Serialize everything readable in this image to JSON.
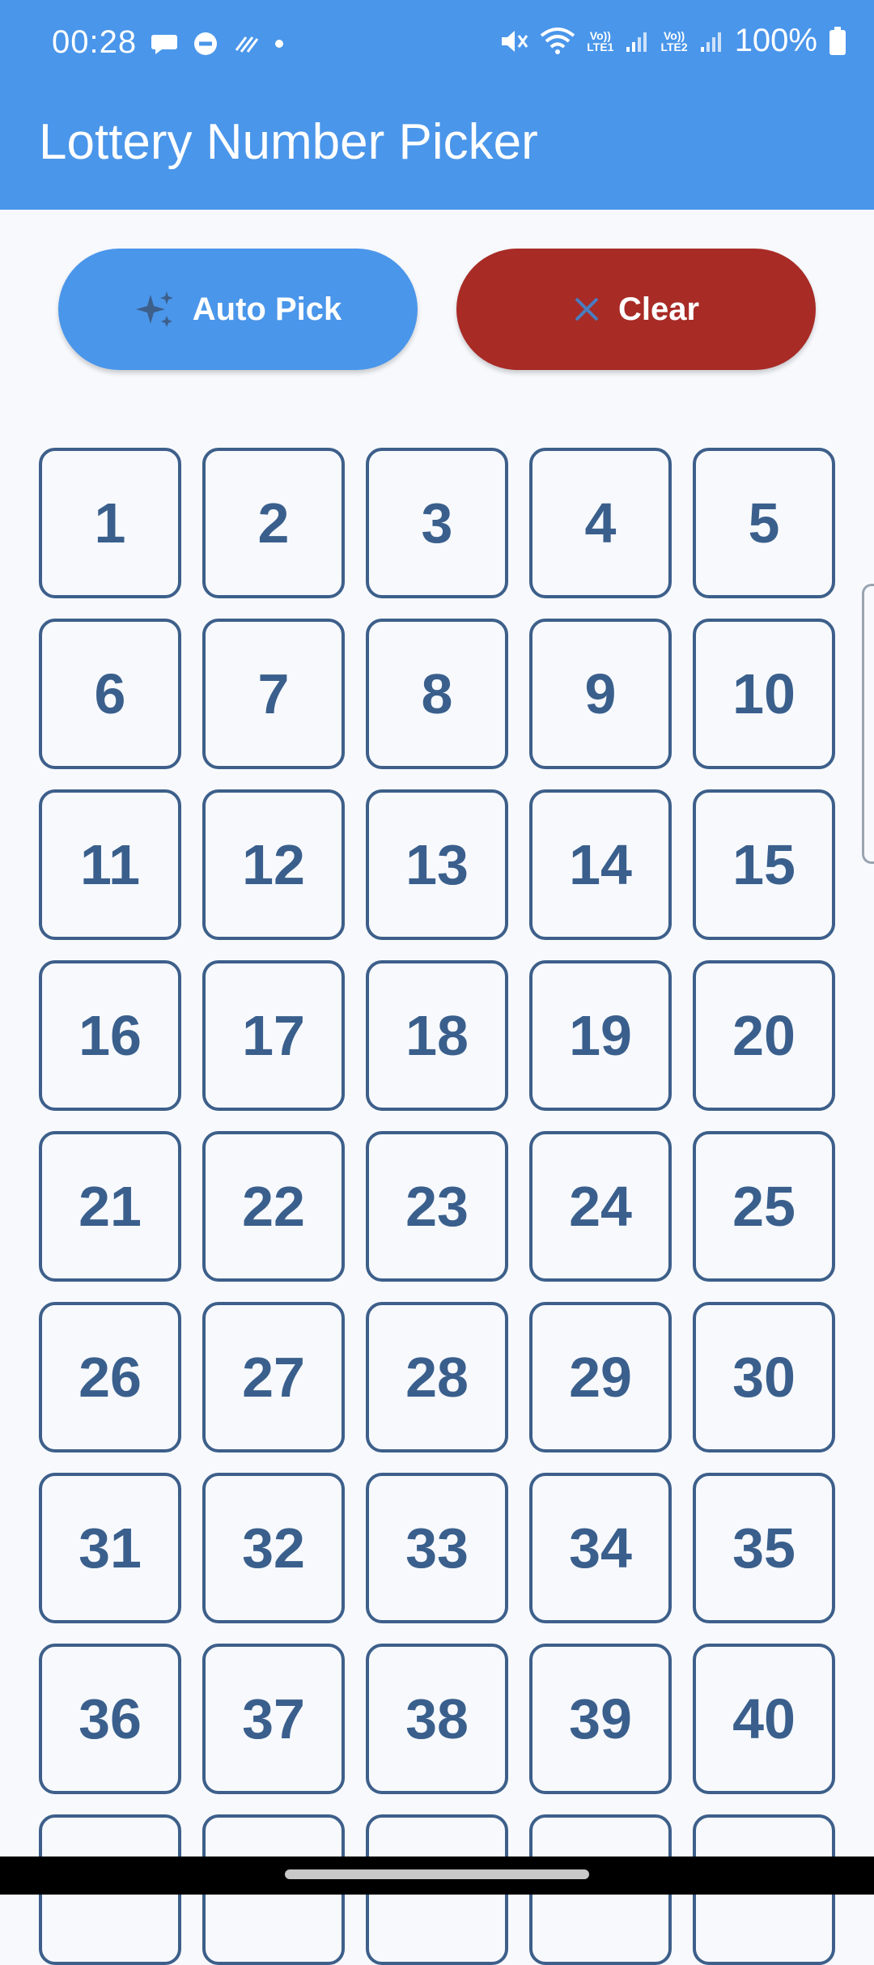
{
  "status_bar": {
    "time": "00:28",
    "battery": "100%",
    "sim1": "LTE1",
    "sim2": "LTE2",
    "volte": "Vo))",
    "icons_left": [
      "chat-icon",
      "dnd-icon",
      "data-saver-icon",
      "dot-icon"
    ],
    "icons_right": [
      "mute-icon",
      "wifi-icon",
      "signal-icon",
      "signal-icon",
      "battery-icon"
    ]
  },
  "app": {
    "title": "Lottery Number Picker"
  },
  "actions": {
    "auto_pick_label": "Auto Pick",
    "clear_label": "Clear"
  },
  "numbers": [
    "1",
    "2",
    "3",
    "4",
    "5",
    "6",
    "7",
    "8",
    "9",
    "10",
    "11",
    "12",
    "13",
    "14",
    "15",
    "16",
    "17",
    "18",
    "19",
    "20",
    "21",
    "22",
    "23",
    "24",
    "25",
    "26",
    "27",
    "28",
    "29",
    "30",
    "31",
    "32",
    "33",
    "34",
    "35",
    "36",
    "37",
    "38",
    "39",
    "40",
    "",
    "",
    "",
    "",
    ""
  ],
  "colors": {
    "primary": "#4a96ea",
    "clear": "#a82b26",
    "number": "#3a5f8c",
    "background": "#f7f9fd"
  }
}
